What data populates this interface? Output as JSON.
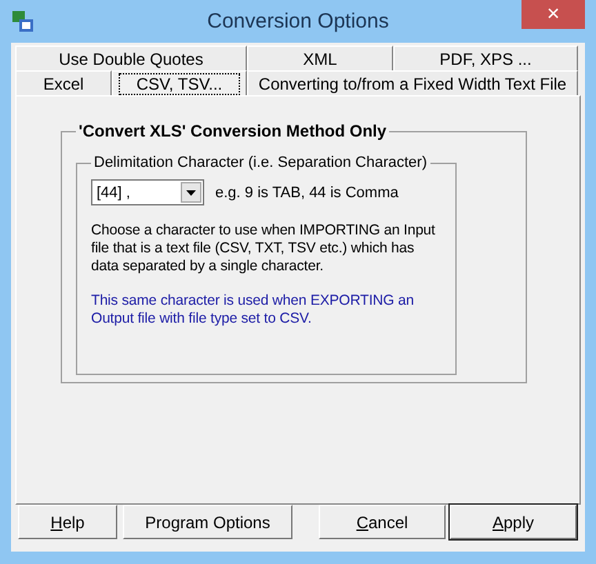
{
  "window": {
    "title": "Conversion Options",
    "close": "×"
  },
  "tab_rows": [
    [
      {
        "label": "Use Double Quotes",
        "selected": false
      },
      {
        "label": "XML",
        "selected": false
      },
      {
        "label": "PDF, XPS ...",
        "selected": false
      }
    ],
    [
      {
        "label": "Excel",
        "selected": false
      },
      {
        "label": "CSV, TSV...",
        "selected": true
      },
      {
        "label": "Converting to/from a Fixed Width Text File",
        "selected": false
      }
    ]
  ],
  "group": {
    "title": "'Convert XLS' Conversion Method Only",
    "inner_group": {
      "title": "Delimitation Character (i.e. Separation Character)",
      "delimiter": {
        "value": "[44] ,",
        "hint": "e.g. 9 is TAB, 44 is Comma"
      },
      "description": "Choose a character to use when IMPORTING an Input file that is a text file (CSV, TXT, TSV etc.) which has data separated by a single character.",
      "note": "This same character is used when EXPORTING an Output file with file type set to CSV."
    }
  },
  "buttons": [
    {
      "accel": "H",
      "rest": "elp",
      "default": false
    },
    {
      "rest": "Program Options",
      "default": false
    },
    {
      "accel": "C",
      "rest": "ancel",
      "default": false
    },
    {
      "accel": "A",
      "rest": "pply",
      "default": true
    }
  ]
}
